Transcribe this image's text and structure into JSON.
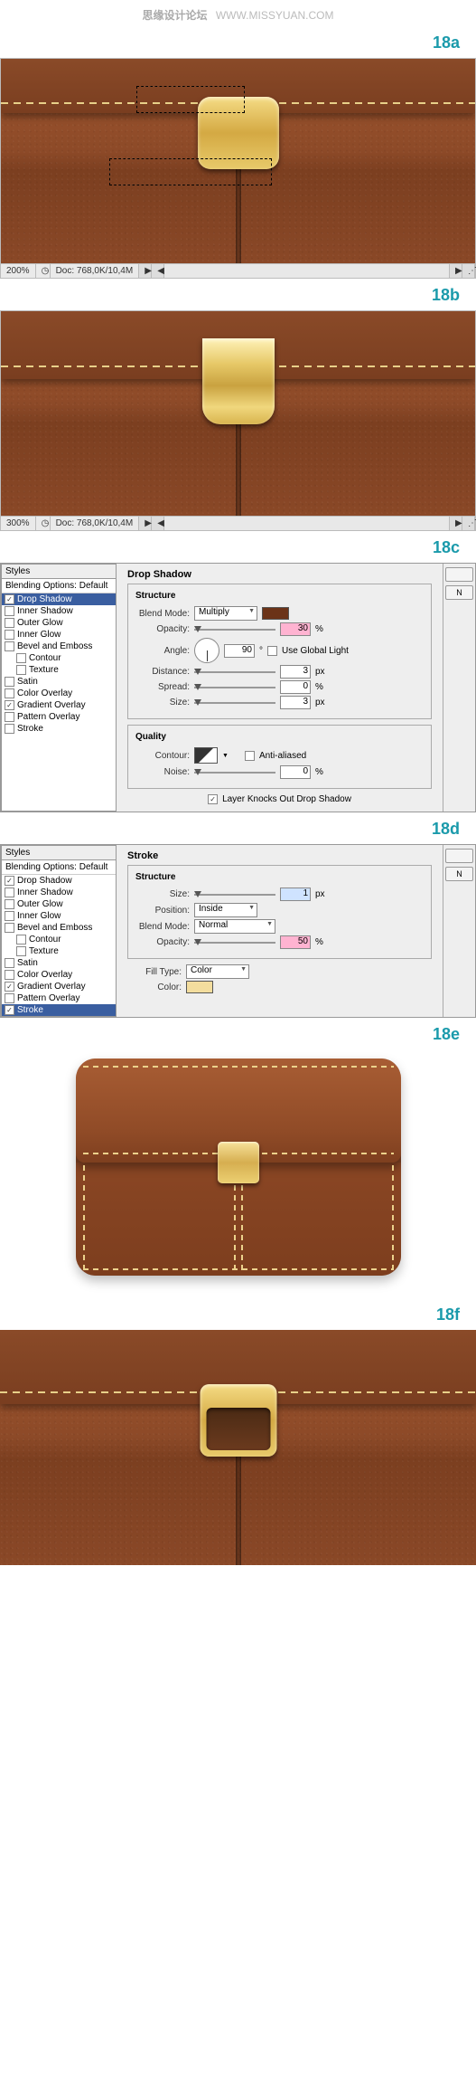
{
  "credit": {
    "cn": "思缘设计论坛",
    "url": "WWW.MISSYUAN.COM"
  },
  "steps": {
    "a": "18a",
    "b": "18b",
    "c": "18c",
    "d": "18d",
    "e": "18e",
    "f": "18f"
  },
  "status_a": {
    "zoom": "200%",
    "doc": "Doc: 768,0K/10,4M"
  },
  "status_b": {
    "zoom": "300%",
    "doc": "Doc: 768,0K/10,4M"
  },
  "styles": {
    "header": "Styles",
    "blending": "Blending Options: Default",
    "items": [
      "Drop Shadow",
      "Inner Shadow",
      "Outer Glow",
      "Inner Glow",
      "Bevel and Emboss",
      "Contour",
      "Texture",
      "Satin",
      "Color Overlay",
      "Gradient Overlay",
      "Pattern Overlay",
      "Stroke"
    ]
  },
  "panel_c": {
    "title": "Drop Shadow",
    "structure": "Structure",
    "blend_mode_lbl": "Blend Mode:",
    "blend_mode": "Multiply",
    "opacity_lbl": "Opacity:",
    "opacity": "30",
    "pct": "%",
    "angle_lbl": "Angle:",
    "angle": "90",
    "deg": "°",
    "global": "Use Global Light",
    "distance_lbl": "Distance:",
    "distance": "3",
    "px": "px",
    "spread_lbl": "Spread:",
    "spread": "0",
    "size_lbl": "Size:",
    "size": "3",
    "quality": "Quality",
    "contour_lbl": "Contour:",
    "aa": "Anti-aliased",
    "noise_lbl": "Noise:",
    "noise": "0",
    "knock": "Layer Knocks Out Drop Shadow",
    "sidebtn": "N"
  },
  "panel_d": {
    "title": "Stroke",
    "structure": "Structure",
    "size_lbl": "Size:",
    "size": "1",
    "px": "px",
    "position_lbl": "Position:",
    "position": "Inside",
    "blend_mode_lbl": "Blend Mode:",
    "blend_mode": "Normal",
    "opacity_lbl": "Opacity:",
    "opacity": "50",
    "pct": "%",
    "filltype_lbl": "Fill Type:",
    "filltype": "Color",
    "color_lbl": "Color:",
    "sidebtn": "N"
  }
}
